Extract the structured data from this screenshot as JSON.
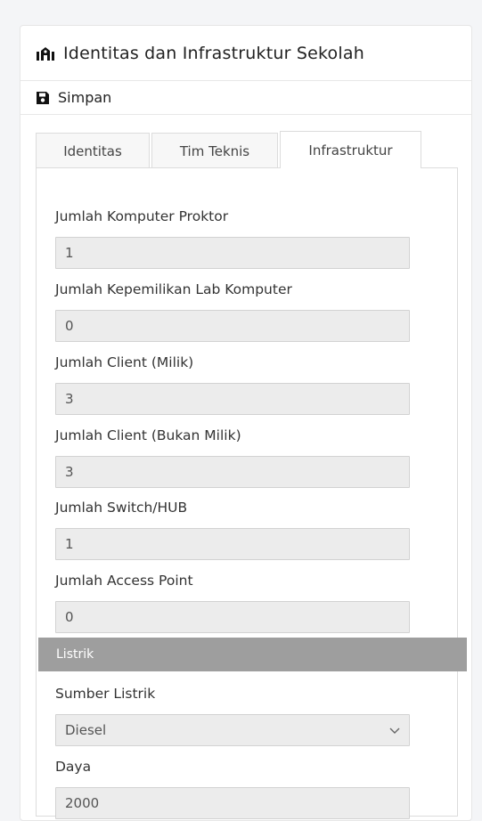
{
  "header": {
    "title": "Identitas dan Infrastruktur Sekolah"
  },
  "toolbar": {
    "save_label": "Simpan"
  },
  "tabs": [
    {
      "label": "Identitas"
    },
    {
      "label": "Tim Teknis"
    },
    {
      "label": "Infrastruktur"
    }
  ],
  "active_tab": "Infrastruktur",
  "fields": [
    {
      "label": "Jumlah Komputer Proktor",
      "value": "1"
    },
    {
      "label": "Jumlah Kepemilikan Lab Komputer",
      "value": "0"
    },
    {
      "label": "Jumlah Client (Milik)",
      "value": "3"
    },
    {
      "label": "Jumlah Client (Bukan Milik)",
      "value": "3"
    },
    {
      "label": "Jumlah Switch/HUB",
      "value": "1"
    },
    {
      "label": "Jumlah Access Point",
      "value": "0"
    }
  ],
  "listrik": {
    "section_title": "Listrik",
    "sumber": {
      "label": "Sumber Listrik",
      "value": "Diesel"
    },
    "daya": {
      "label": "Daya",
      "value": "2000"
    }
  },
  "colors": {
    "section_bar": "#9e9e9e",
    "input_bg": "#ececec",
    "border": "#dcdcdc"
  },
  "icons": {
    "header": "school-building-icon",
    "save": "floppy-disk-icon",
    "select": "chevron-down-icon"
  }
}
